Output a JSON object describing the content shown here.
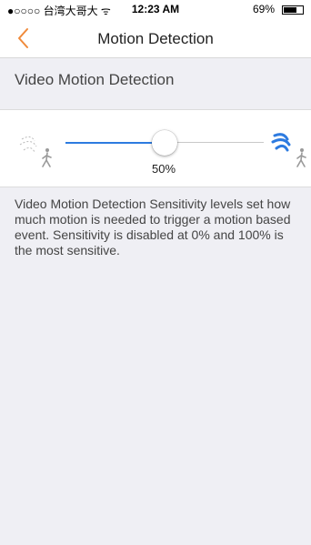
{
  "status_bar": {
    "carrier": "●○○○○ 台湾大哥大 ᯤ",
    "time": "12:23 AM",
    "battery_percent": "69%",
    "battery_level": 0.69
  },
  "nav": {
    "title": "Motion Detection",
    "back_icon": "chevron-left-icon",
    "accent_color": "#f08a3a"
  },
  "section": {
    "title": "Video Motion Detection"
  },
  "slider": {
    "value": 0.5,
    "value_text": "50%",
    "low_icon": "motion-low-icon",
    "high_icon": "motion-high-icon",
    "track_color": "#2d7be0"
  },
  "description": {
    "text": "Video Motion Detection Sensitivity levels set how much motion is needed to trigger a motion based event. Sensitivity is disabled at 0% and 100% is the most sensitive."
  }
}
